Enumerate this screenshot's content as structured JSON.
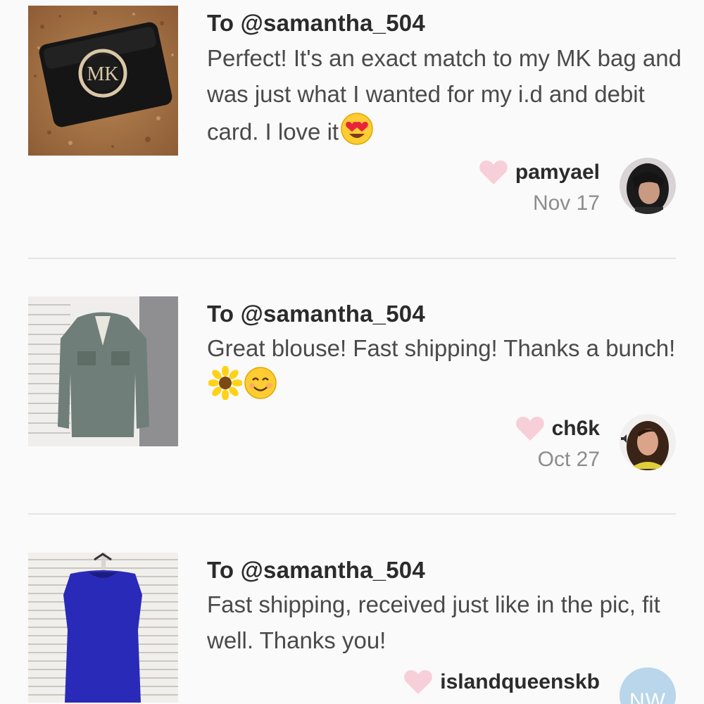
{
  "colors": {
    "background": "#fbfafa",
    "divider": "#e6e4e4",
    "heart": "#f7cfd8",
    "text_primary": "#2b2b2b",
    "text_secondary": "#4a4a4a",
    "date": "#8c8c8c",
    "initials_avatar": "#b9d6ea"
  },
  "reviews": [
    {
      "recipient": "To @samantha_504",
      "message": "Perfect! It's an exact match to my MK bag and was just what I wanted for my i.d and debit card. I love it",
      "emojis": [
        "heart-eyes-emoji"
      ],
      "username": "pamyael",
      "date": "Nov 17",
      "thumbnail_icon": "mk-wallet-photo",
      "thumbnail_logo": "MK"
    },
    {
      "recipient": "To @samantha_504",
      "message": "Great blouse! Fast shipping! Thanks a bunch!",
      "emojis": [
        "sunflower-emoji",
        "smiling-face-emoji"
      ],
      "username": "ch6k",
      "date": "Oct 27",
      "thumbnail_icon": "green-blouse-photo"
    },
    {
      "recipient": "To @samantha_504",
      "message": "Fast shipping, received just like in the pic, fit well. Thanks you!",
      "emojis": [],
      "username": "islandqueenskb",
      "date": "",
      "thumbnail_icon": "blue-top-photo",
      "avatar_initials": "NW"
    }
  ]
}
